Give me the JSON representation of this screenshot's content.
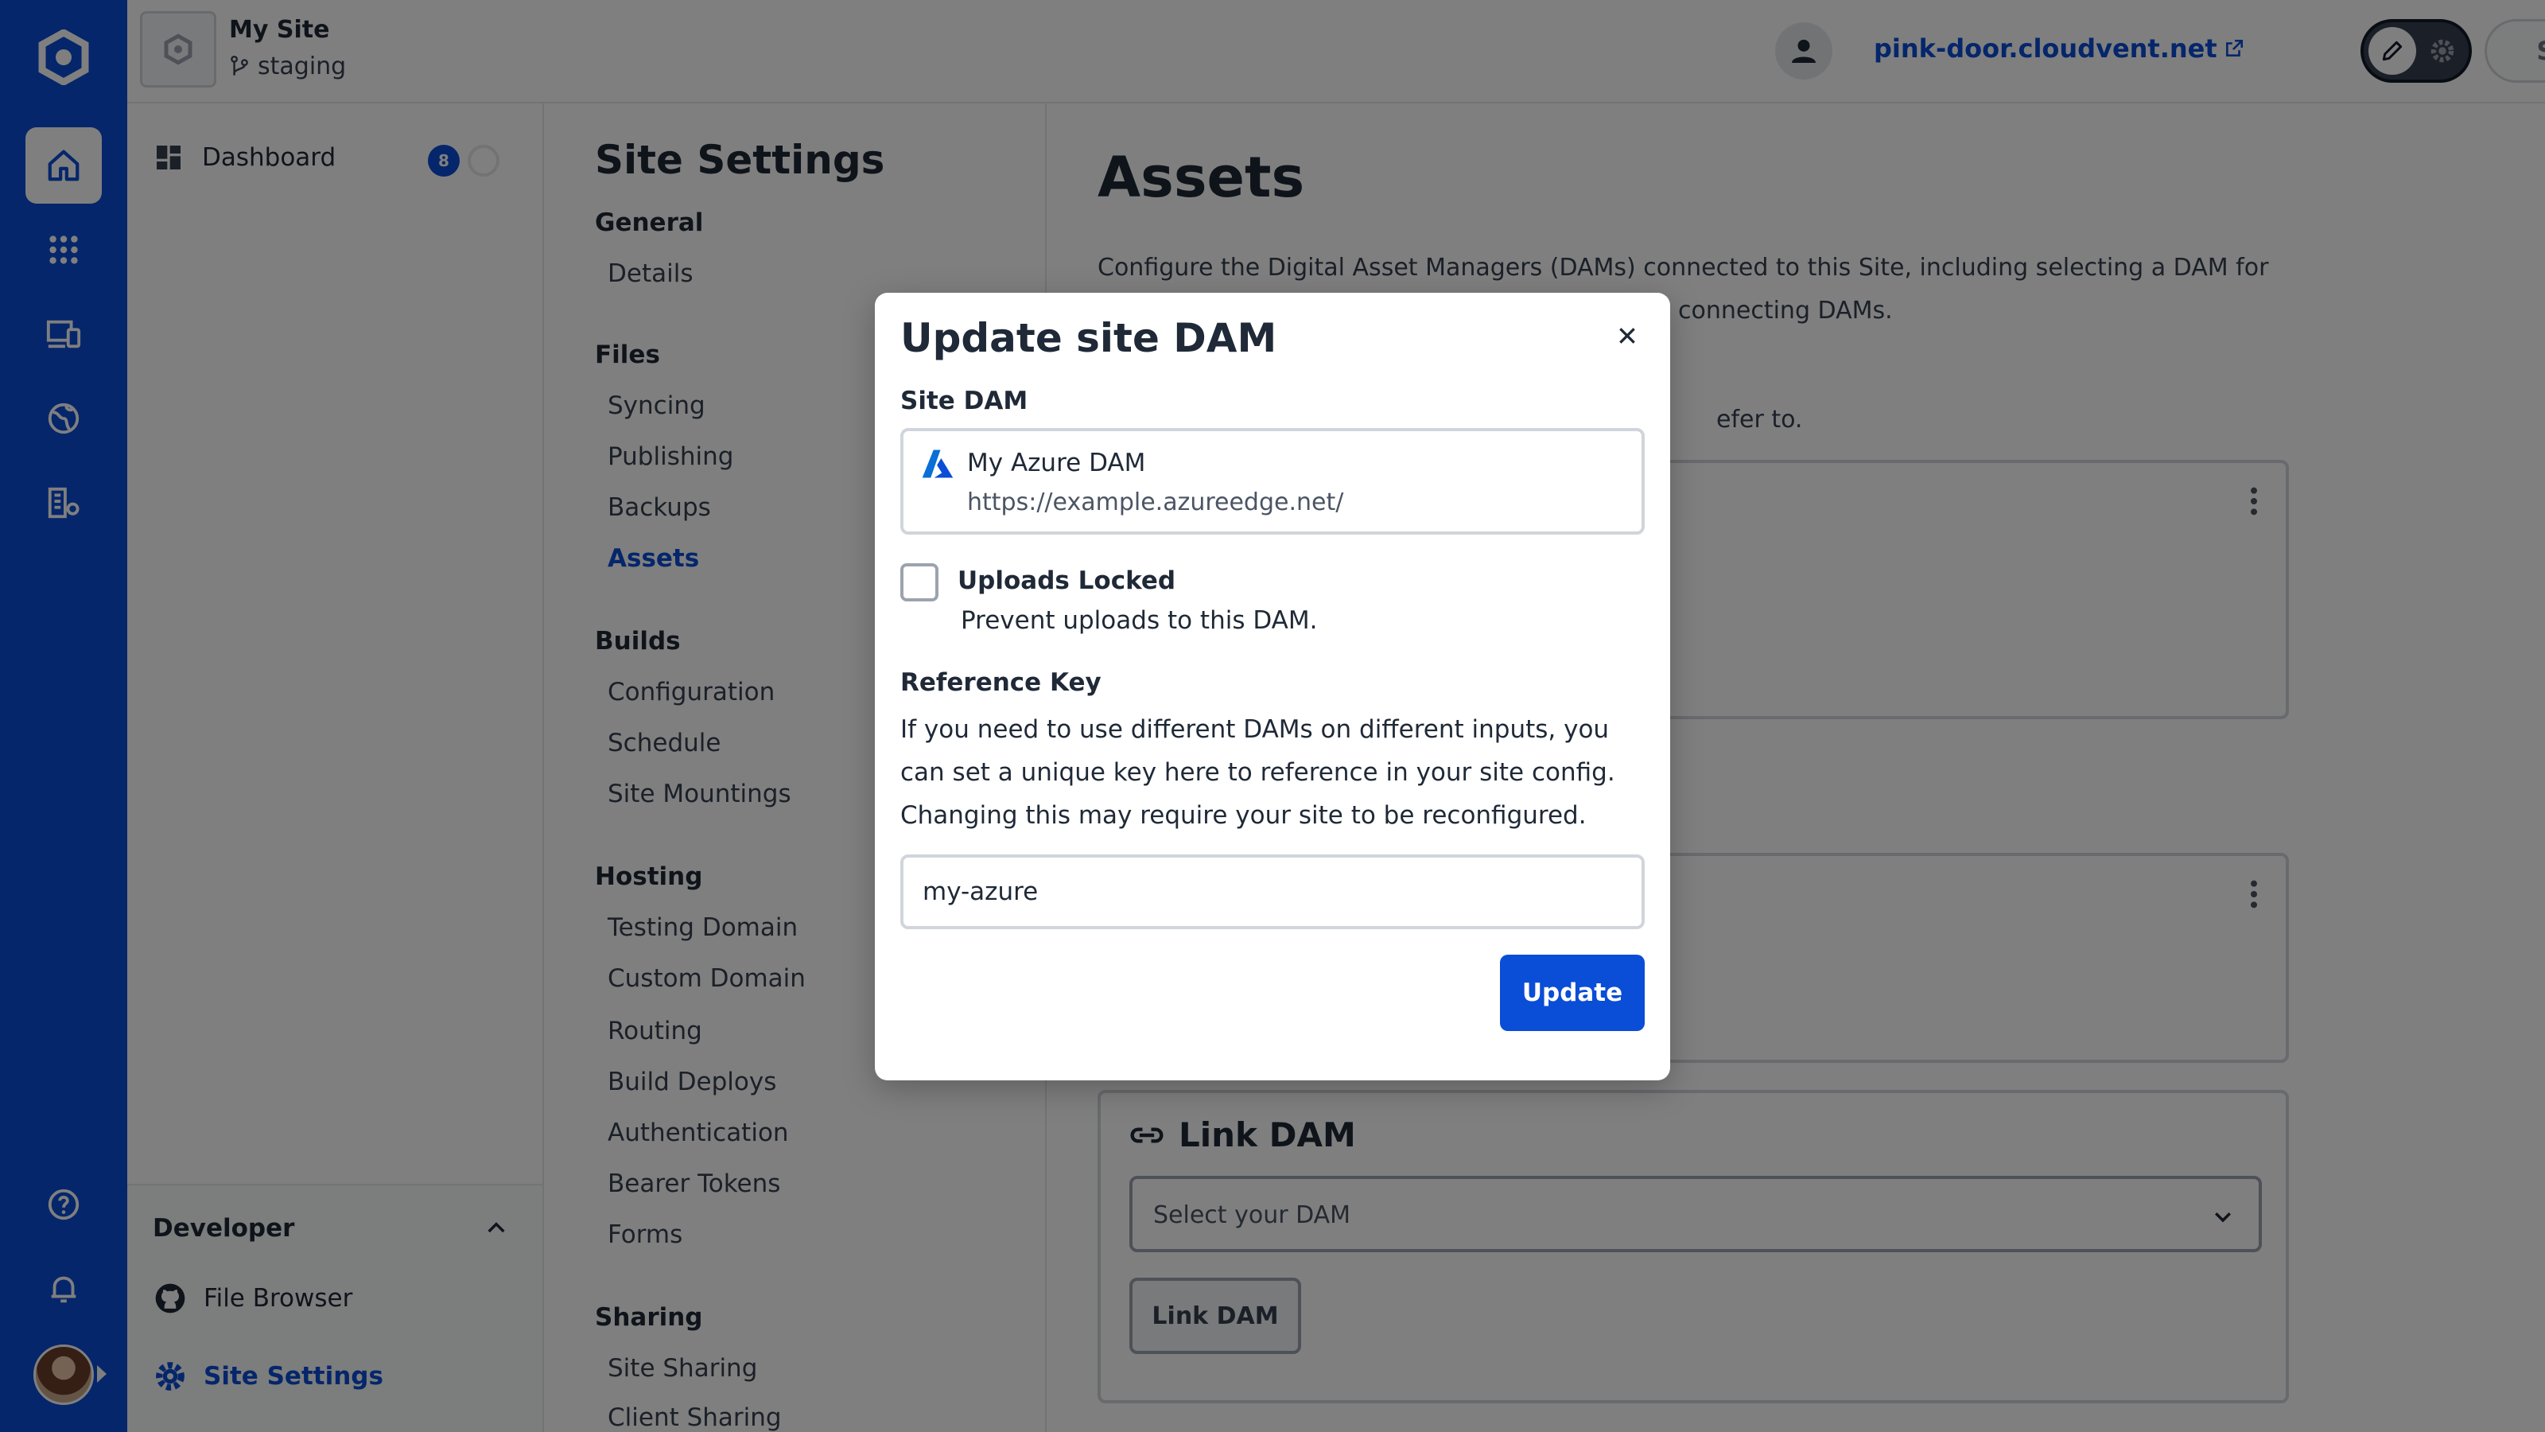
{
  "colors": {
    "brand": "#0a4dd6",
    "overlay": "rgba(0,0,0,0.5)"
  },
  "rail": {
    "items": [
      "home-icon",
      "apps-grid-icon",
      "devices-icon",
      "globe-icon",
      "organization-settings-icon",
      "help-icon",
      "bell-icon"
    ],
    "active": "home-icon"
  },
  "topbar": {
    "site_name": "My Site",
    "branch": "staging",
    "domain": "pink-door.cloudvent.net",
    "save_label": "Save"
  },
  "leftnav": {
    "dashboard_label": "Dashboard",
    "dashboard_badge": "8",
    "developer_title": "Developer",
    "file_browser_label": "File Browser",
    "site_settings_label": "Site Settings"
  },
  "settings_nav": {
    "title": "Site Settings",
    "groups": [
      {
        "label": "General",
        "items": [
          "Details"
        ]
      },
      {
        "label": "Files",
        "items": [
          "Syncing",
          "Publishing",
          "Backups",
          "Assets"
        ]
      },
      {
        "label": "Builds",
        "items": [
          "Configuration",
          "Schedule",
          "Site Mountings"
        ]
      },
      {
        "label": "Hosting",
        "items": [
          "Testing Domain",
          "Custom Domain",
          "Routing",
          "Build Deploys",
          "Authentication",
          "Bearer Tokens",
          "Forms"
        ]
      },
      {
        "label": "Sharing",
        "items": [
          "Site Sharing",
          "Client Sharing"
        ]
      }
    ],
    "active_item": "Assets"
  },
  "main": {
    "title": "Assets",
    "description_line1": "Configure the Digital Asset Managers (DAMs) connected to this Site, including selecting a DAM for",
    "description_line2_visible": "connecting DAMs.",
    "description2_visible": "efer to.",
    "link_dam": {
      "title": "Link DAM",
      "select_placeholder": "Select your DAM",
      "button_label": "Link DAM"
    }
  },
  "modal": {
    "title": "Update site DAM",
    "site_dam_label": "Site DAM",
    "dam_name": "My Azure DAM",
    "dam_url": "https://example.azureedge.net/",
    "uploads_locked_label": "Uploads Locked",
    "uploads_locked_help": "Prevent uploads to this DAM.",
    "uploads_locked_checked": false,
    "reference_key_label": "Reference Key",
    "reference_key_help": "If you need to use different DAMs on different inputs, you can set a unique key here to reference in your site config. Changing this may require your site to be reconfigured.",
    "reference_key_value": "my-azure",
    "update_label": "Update"
  }
}
